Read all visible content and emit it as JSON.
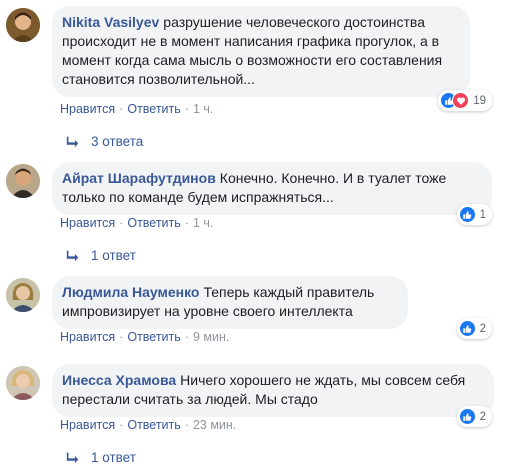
{
  "comments": [
    {
      "author": "Nikita Vasilyev",
      "text": "разрушение человеческого достоинства происходит не в момент написания графика прогулок, а в момент когда сама мысль о возможности его составления становится позволительной...",
      "like_label": "Нравится",
      "reply_label": "Ответить",
      "time": "1 ч.",
      "reaction_icons": [
        "like-icon",
        "love-icon"
      ],
      "reaction_count": "19",
      "replies_label": "3 ответа"
    },
    {
      "author": "Айрат Шарафутдинов",
      "text": "Конечно. Конечно. И в туалет тоже только по команде будем испражняться...",
      "like_label": "Нравится",
      "reply_label": "Ответить",
      "time": "1 ч.",
      "reaction_icons": [
        "like-icon"
      ],
      "reaction_count": "1",
      "replies_label": "1 ответ"
    },
    {
      "author": "Людмила Науменко",
      "text": "Теперь каждый правитель импровизирует на уровне своего интеллекта",
      "like_label": "Нравится",
      "reply_label": "Ответить",
      "time": "9 мин.",
      "reaction_icons": [
        "like-icon"
      ],
      "reaction_count": "2",
      "replies_label": ""
    },
    {
      "author": "Инесса Храмова",
      "text": "Ничего хорошего не ждать, мы совсем себя перестали считать за людей. Мы стадо",
      "like_label": "Нравится",
      "reply_label": "Ответить",
      "time": "23 мин.",
      "reaction_icons": [
        "like-icon"
      ],
      "reaction_count": "2",
      "replies_label": "1 ответ"
    }
  ],
  "separator": "·",
  "colors": {
    "link": "#385898",
    "bubble": "#f2f3f5",
    "like": "#1877f2",
    "love": "#f33e58",
    "meta": "#90949c"
  }
}
